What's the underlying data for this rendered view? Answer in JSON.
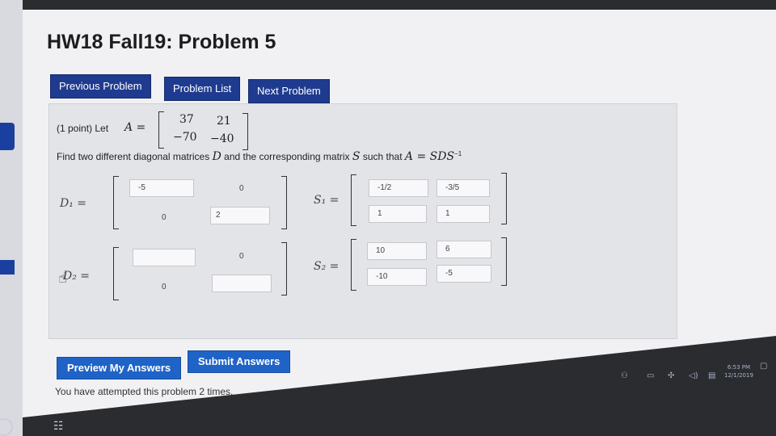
{
  "title": "HW18 Fall19: Problem 5",
  "nav": {
    "previous": "Previous Problem",
    "list": "Problem List",
    "next": "Next Problem"
  },
  "problem": {
    "points": "(1 point) Let",
    "a_var": "A =",
    "matrix_A": [
      "37",
      "21",
      "−70",
      "−40"
    ],
    "find_text": "Find two different diagonal matrices",
    "d_var": "D",
    "corr_text": "and the corresponding matrix",
    "s_var": "S",
    "such_that": "such that",
    "formula": "A = SDS",
    "sup": "−1"
  },
  "d1": {
    "label": "D₁ =",
    "a11": "-5",
    "a12": "0",
    "a21": "0",
    "a22": "2"
  },
  "s1": {
    "label": "S₁ =",
    "a11": "-1/2",
    "a12": "-3/5",
    "a21": "1",
    "a22": "1"
  },
  "d2": {
    "label": "D₂ =",
    "a11": "",
    "a12": "0",
    "a21": "0",
    "a22": ""
  },
  "s2": {
    "label": "S₂ =",
    "a11": "10",
    "a12": "6",
    "a21": "-10",
    "a22": "-5"
  },
  "actions": {
    "preview": "Preview My Answers",
    "submit": "Submit Answers"
  },
  "attempt_text": "You have attempted this problem 2 times.",
  "clock": {
    "time": "6:53 PM",
    "date": "12/1/2019"
  },
  "colors": {
    "nav_button": "#1f3b8f",
    "action_button": "#1f63c7"
  }
}
